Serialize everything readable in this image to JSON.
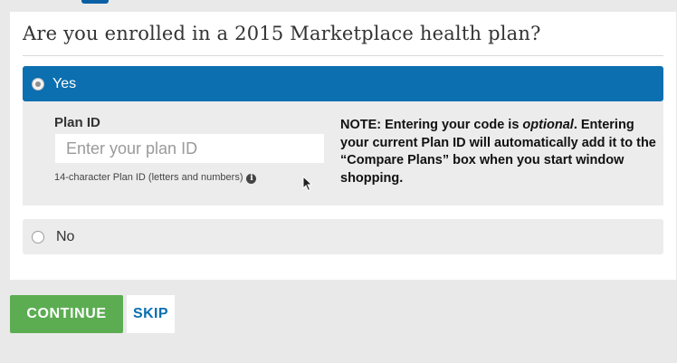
{
  "question": "Are you enrolled in a 2015 Marketplace health plan?",
  "options": {
    "yes": {
      "label": "Yes",
      "selected": true
    },
    "no": {
      "label": "No",
      "selected": false
    }
  },
  "plan_id": {
    "label": "Plan ID",
    "placeholder": "Enter your plan ID",
    "value": "",
    "hint": "14-character Plan ID (letters and numbers)",
    "info_icon": "info-icon"
  },
  "note": {
    "prefix": "NOTE: Entering your code is ",
    "emphasis": "optional",
    "suffix": ". Entering your current Plan ID will automatically add it to the “Compare Plans” box when you start window shopping."
  },
  "buttons": {
    "continue": "CONTINUE",
    "skip": "SKIP"
  },
  "colors": {
    "selected_option_bg": "#0b6fb0",
    "continue_bg": "#5cad52",
    "skip_text": "#0b6fb0",
    "page_bg": "#e9e9e9"
  }
}
